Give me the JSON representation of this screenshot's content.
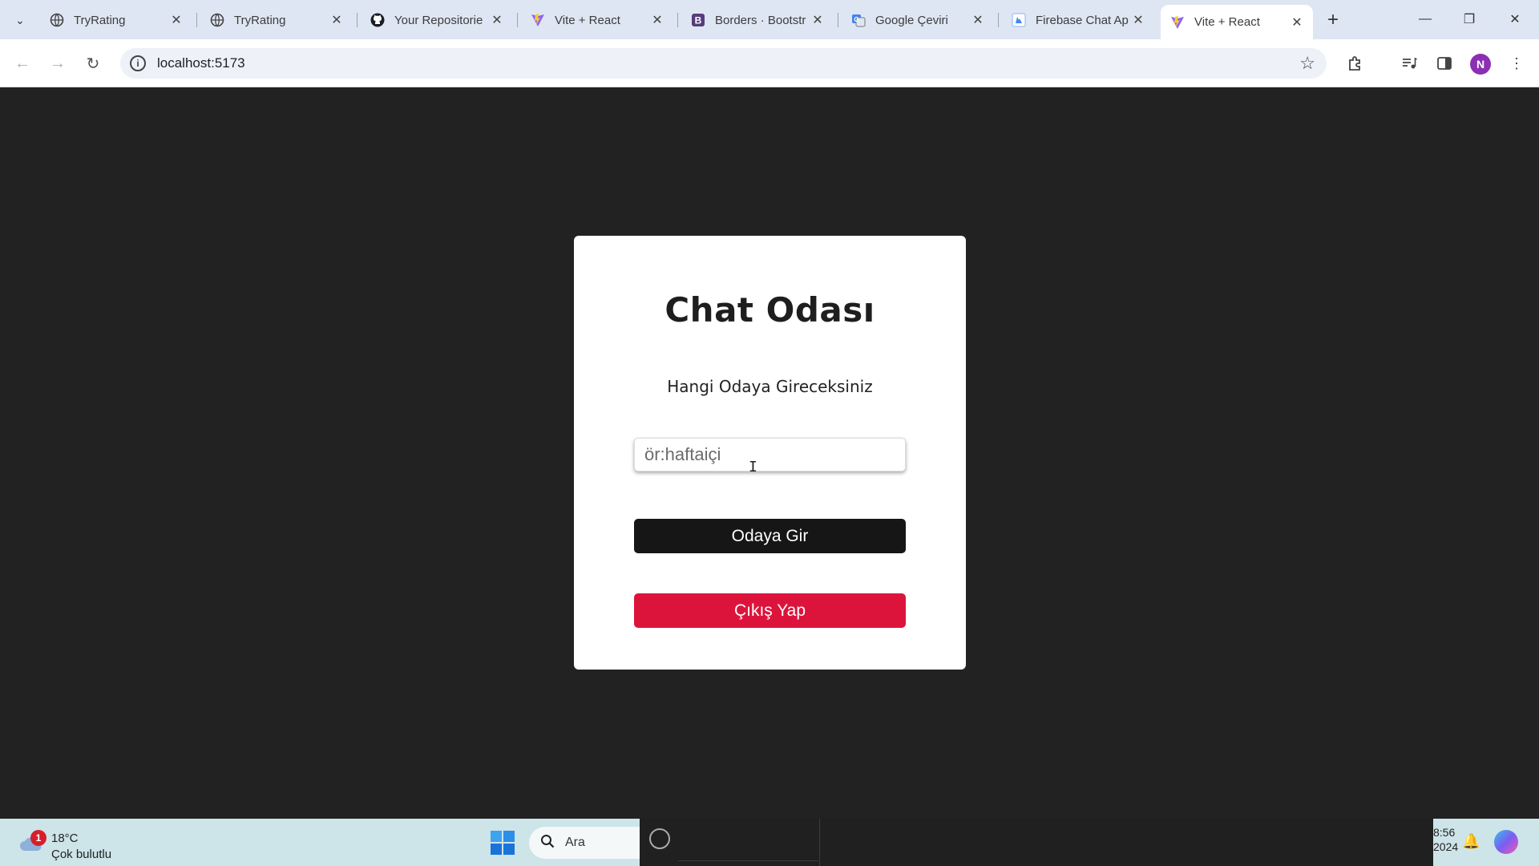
{
  "browser": {
    "tabs": [
      {
        "title": "TryRating",
        "icon": "globe-icon",
        "active": false
      },
      {
        "title": "TryRating",
        "icon": "globe-icon",
        "active": false
      },
      {
        "title": "Your Repositorie",
        "icon": "github-icon",
        "active": false
      },
      {
        "title": "Vite + React",
        "icon": "vite-icon",
        "active": false
      },
      {
        "title": "Borders · Bootstr",
        "icon": "bootstrap-icon",
        "active": false
      },
      {
        "title": "Google Çeviri",
        "icon": "google-translate-icon",
        "active": false
      },
      {
        "title": "Firebase Chat Ap",
        "icon": "firebase-icon",
        "active": false
      },
      {
        "title": "Vite + React",
        "icon": "vite-icon",
        "active": true
      }
    ],
    "url": "localhost:5173",
    "profile_initial": "N"
  },
  "page": {
    "title": "Chat Odası",
    "prompt": "Hangi Odaya Gireceksiniz",
    "room_input": {
      "placeholder": "ör:haftaiçi",
      "value": ""
    },
    "enter_button": "Odaya Gir",
    "logout_button": "Çıkış Yap",
    "colors": {
      "background": "#222222",
      "card": "#ffffff",
      "enter": "#161616",
      "logout": "#dc143c"
    }
  },
  "taskbar": {
    "weather_badge": "1",
    "temperature": "18°C",
    "condition": "Çok bulutlu",
    "search_label": "Ara",
    "clock_time": "8:56",
    "clock_date": "2024"
  }
}
